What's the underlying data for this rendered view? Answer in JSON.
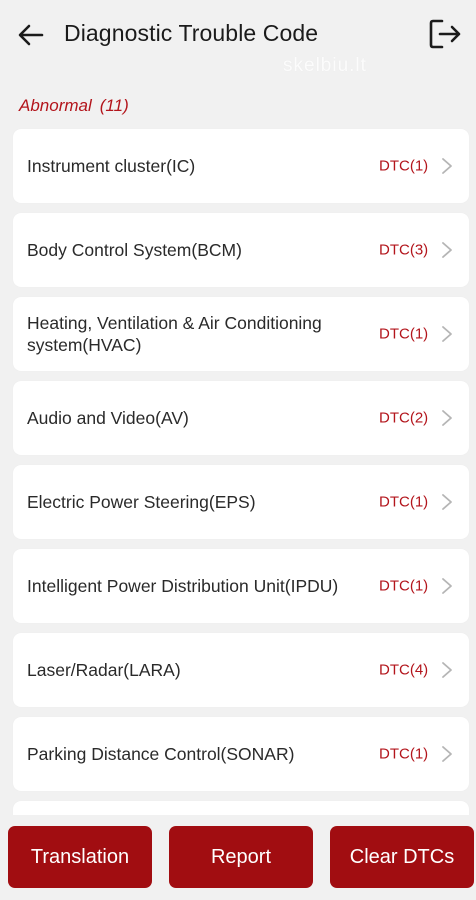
{
  "header": {
    "title": "Diagnostic Trouble Code",
    "back_icon": "arrow-left-icon",
    "exit_icon": "exit-icon"
  },
  "watermark": "skelbiu.lt",
  "section": {
    "label": "Abnormal",
    "count": "(11)"
  },
  "rows": [
    {
      "name": "Instrument cluster(IC)",
      "dtc": "DTC(1)"
    },
    {
      "name": "Body Control System(BCM)",
      "dtc": "DTC(3)"
    },
    {
      "name": "Heating, Ventilation & Air Conditioning system(HVAC)",
      "dtc": "DTC(1)"
    },
    {
      "name": "Audio and Video(AV)",
      "dtc": "DTC(2)"
    },
    {
      "name": "Electric Power Steering(EPS)",
      "dtc": "DTC(1)"
    },
    {
      "name": "Intelligent Power Distribution Unit(IPDU)",
      "dtc": "DTC(1)"
    },
    {
      "name": "Laser/Radar(LARA)",
      "dtc": "DTC(4)"
    },
    {
      "name": "Parking Distance Control(SONAR)",
      "dtc": "DTC(1)"
    },
    {
      "name": "",
      "dtc": ""
    }
  ],
  "footer": {
    "translation_label": "Translation",
    "report_label": "Report",
    "clear_label": "Clear DTCs"
  },
  "colors": {
    "accent": "#b3151c",
    "button_bg": "#a10d11",
    "background": "#f1f1f1",
    "card": "#ffffff"
  }
}
